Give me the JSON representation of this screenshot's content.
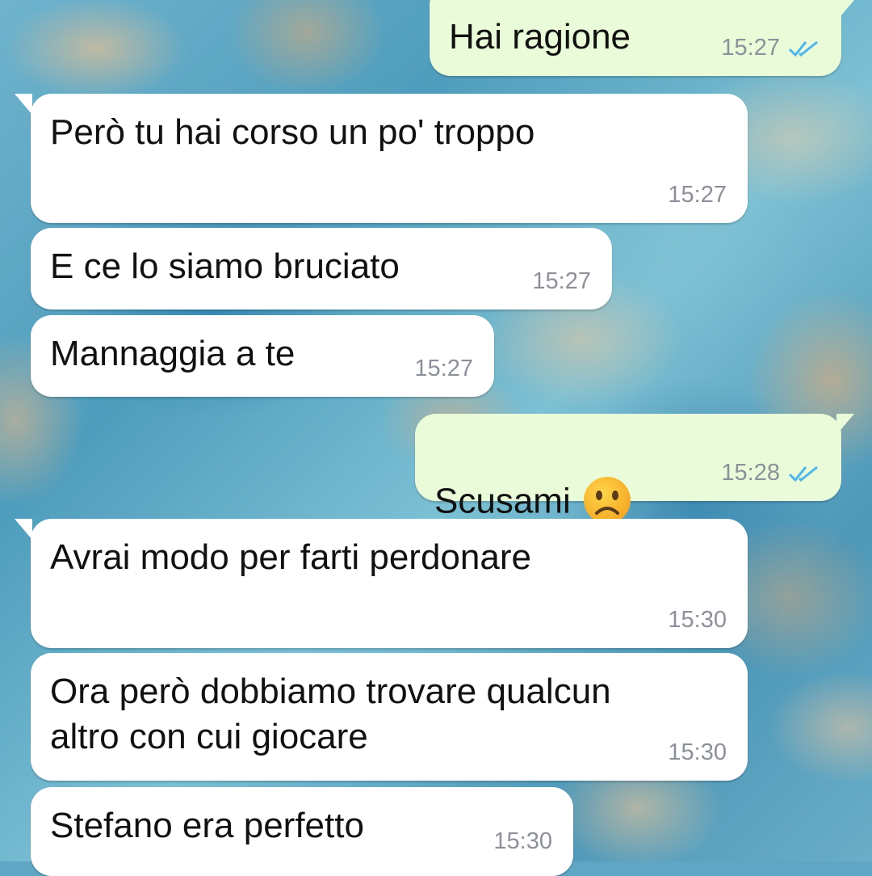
{
  "chat": {
    "messages": [
      {
        "direction": "out",
        "text": "Hai ragione",
        "time": "15:27",
        "status": "read"
      },
      {
        "direction": "in",
        "text": "Però tu hai corso un po' troppo",
        "time": "15:27"
      },
      {
        "direction": "in",
        "text": "E ce lo siamo bruciato",
        "time": "15:27"
      },
      {
        "direction": "in",
        "text": "Mannaggia a te",
        "time": "15:27"
      },
      {
        "direction": "out",
        "text": "Scusami",
        "emoji": "☹️",
        "time": "15:28",
        "status": "read"
      },
      {
        "direction": "in",
        "text": "Avrai modo per farti perdonare",
        "time": "15:30"
      },
      {
        "direction": "in",
        "text": "Ora però dobbiamo trovare qualcun\naltro con cui giocare",
        "time": "15:30"
      },
      {
        "direction": "in",
        "text": "Stefano era perfetto",
        "time": "15:30"
      }
    ]
  },
  "colors": {
    "incoming_bubble": "#ffffff",
    "outgoing_bubble": "#e9fbd9",
    "read_ticks": "#4fb6ec",
    "timestamp": "#8c9199"
  },
  "icons": {
    "read_receipt": "double-check-icon",
    "emoji": "frowning-face-emoji"
  }
}
